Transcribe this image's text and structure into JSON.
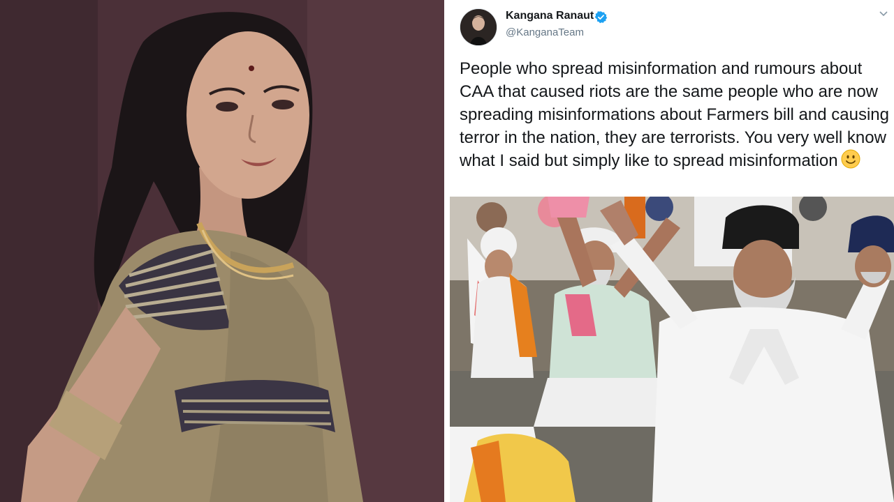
{
  "tweet": {
    "display_name": "Kangana Ranaut",
    "handle": "@KanganaTeam",
    "verified": true,
    "text": "People who spread misinformation and rumours about CAA that caused riots are the same people who are now spreading misinformations about Farmers bill and causing terror in the nation, they are terrorists. You very well know what I said but simply like to spread misinformation",
    "emoji": "slightly-smiling-face",
    "colors": {
      "verified": "#1da1f2",
      "name": "#14171a",
      "handle": "#657786"
    }
  },
  "images": {
    "portrait": "woman-in-saree-portrait",
    "photo": "farmers-protest-crowd"
  },
  "icons": {
    "verified": "verified-badge-icon",
    "menu": "chevron-down-icon",
    "emoji": "smile-emoji-icon"
  }
}
